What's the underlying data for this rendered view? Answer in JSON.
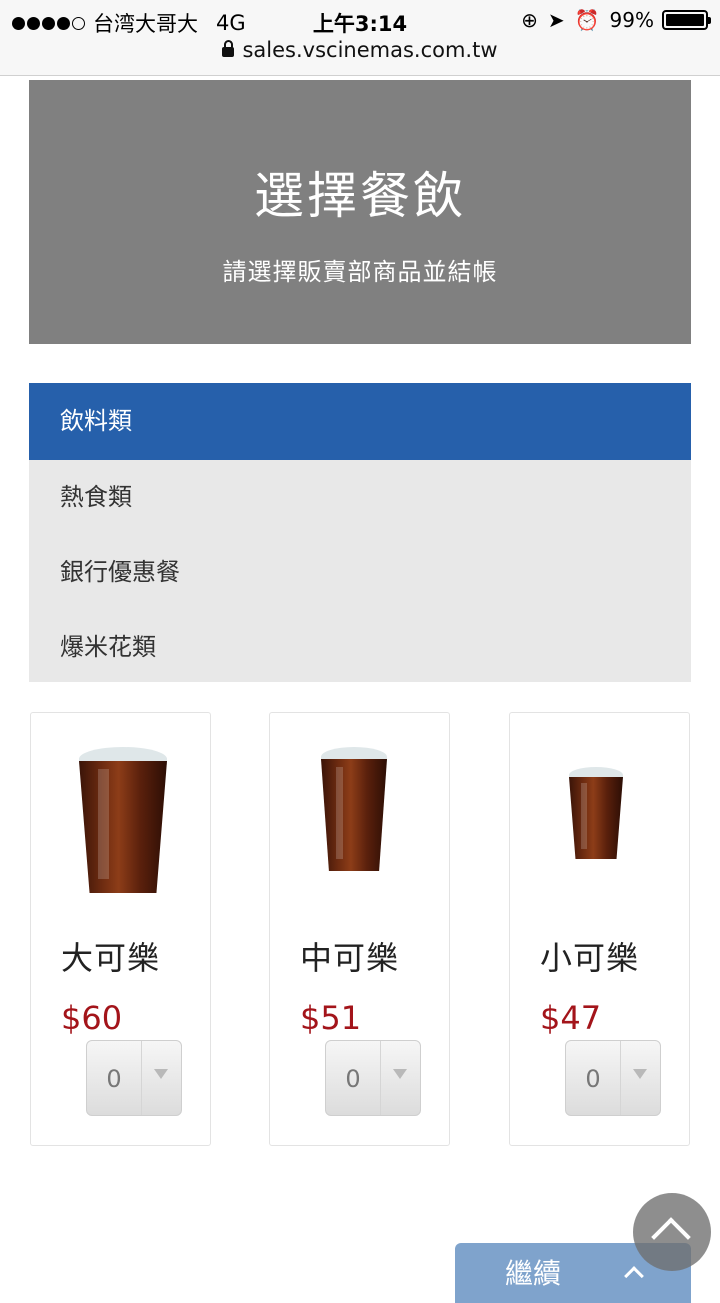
{
  "status_bar": {
    "carrier": "台湾大哥大",
    "network": "4G",
    "time": "上午3:14",
    "battery": "99%",
    "battery_level": 0.99,
    "url": "sales.vscinemas.com.tw"
  },
  "hero": {
    "title": "選擇餐飲",
    "subtitle": "請選擇販賣部商品並結帳"
  },
  "categories": [
    {
      "label": "飲料類",
      "active": true
    },
    {
      "label": "熱食類",
      "active": false
    },
    {
      "label": "銀行優惠餐",
      "active": false
    },
    {
      "label": "爆米花類",
      "active": false
    }
  ],
  "products": [
    {
      "name": "大可樂",
      "price": "$60",
      "quantity": "0"
    },
    {
      "name": "中可樂",
      "price": "$51",
      "quantity": "0"
    },
    {
      "name": "小可樂",
      "price": "$47",
      "quantity": "0"
    }
  ],
  "continue_button": {
    "label": "繼續"
  },
  "colors": {
    "accent": "#2660ab",
    "price": "#a3141a",
    "hero_bg": "#808080",
    "continue_bg": "#7fa3cc"
  },
  "icons": [
    "lock-icon",
    "rotation-lock-icon",
    "location-arrow-icon",
    "alarm-icon",
    "battery-icon",
    "chevron-down-icon",
    "chevron-up-icon"
  ]
}
